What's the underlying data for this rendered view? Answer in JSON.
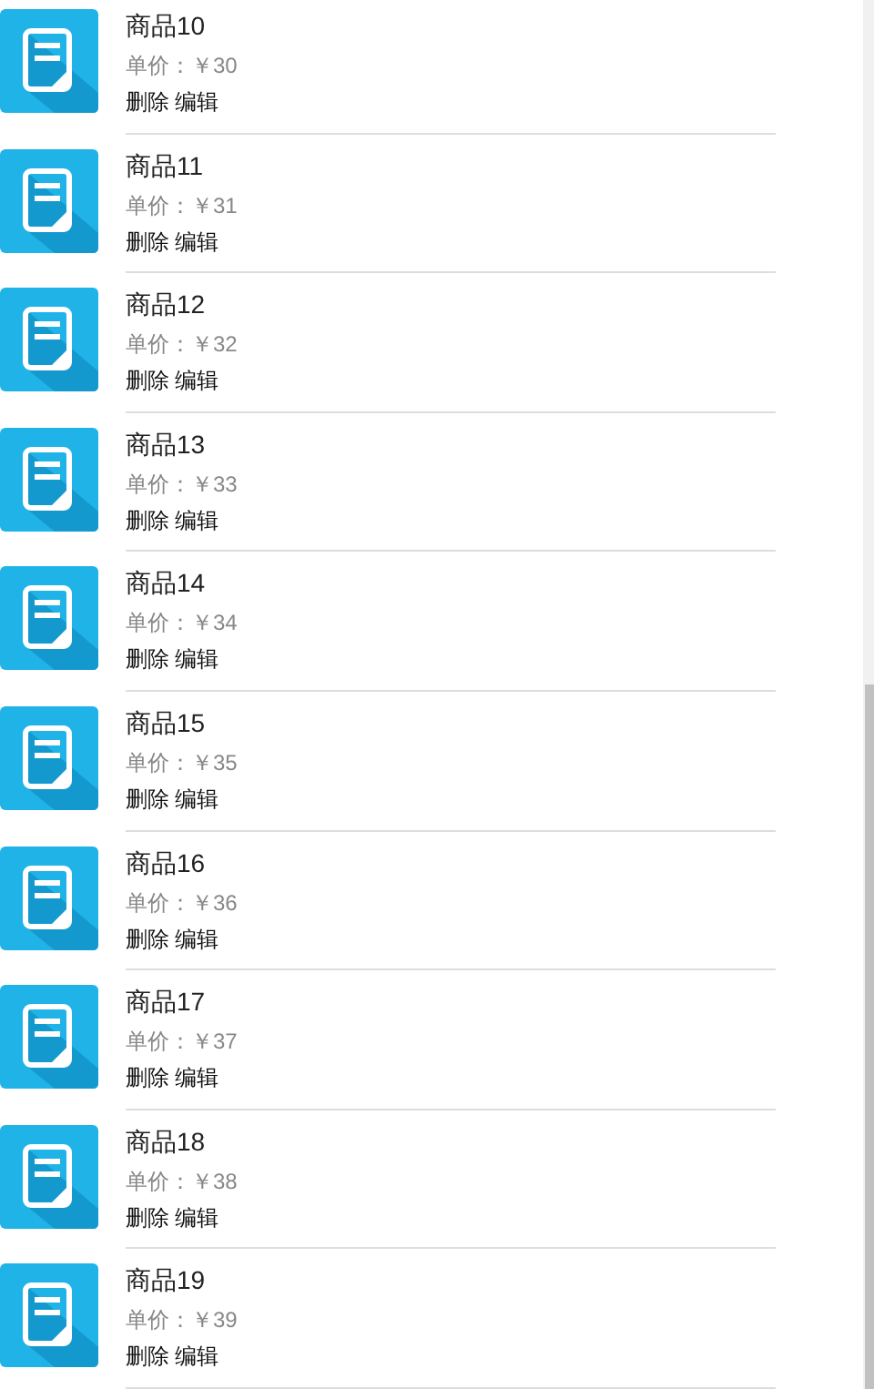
{
  "items": [
    {
      "name": "商品10",
      "price_label": "单价：",
      "price": "￥30",
      "actions": [
        "删除",
        "编辑"
      ]
    },
    {
      "name": "商品11",
      "price_label": "单价：",
      "price": "￥31",
      "actions": [
        "删除",
        "编辑"
      ]
    },
    {
      "name": "商品12",
      "price_label": "单价：",
      "price": "￥32",
      "actions": [
        "删除",
        "编辑"
      ]
    },
    {
      "name": "商品13",
      "price_label": "单价：",
      "price": "￥33",
      "actions": [
        "删除",
        "编辑"
      ]
    },
    {
      "name": "商品14",
      "price_label": "单价：",
      "price": "￥34",
      "actions": [
        "删除",
        "编辑"
      ]
    },
    {
      "name": "商品15",
      "price_label": "单价：",
      "price": "￥35",
      "actions": [
        "删除",
        "编辑"
      ]
    },
    {
      "name": "商品16",
      "price_label": "单价：",
      "price": "￥36",
      "actions": [
        "删除",
        "编辑"
      ]
    },
    {
      "name": "商品17",
      "price_label": "单价：",
      "price": "￥37",
      "actions": [
        "删除",
        "编辑"
      ]
    },
    {
      "name": "商品18",
      "price_label": "单价：",
      "price": "￥38",
      "actions": [
        "删除",
        "编辑"
      ]
    },
    {
      "name": "商品19",
      "price_label": "单价：",
      "price": "￥39",
      "actions": [
        "删除",
        "编辑"
      ]
    }
  ]
}
